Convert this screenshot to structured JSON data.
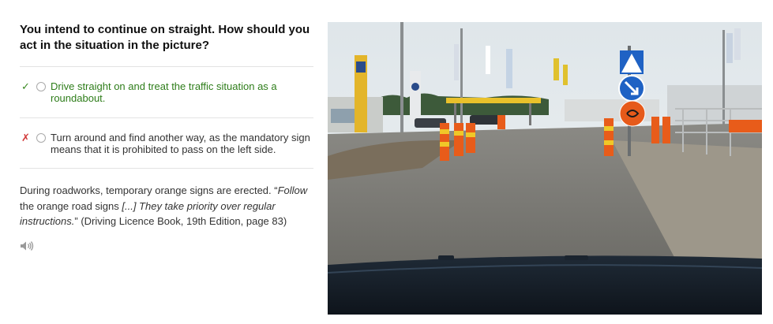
{
  "question": {
    "text": "You intend to continue on straight. How should you act in the situation in the picture?"
  },
  "options": [
    {
      "text": "Drive straight on and treat the traffic situation as a roundabout.",
      "status": "correct",
      "marker": "✓",
      "color": "#2e7d1a"
    },
    {
      "text": "Turn around and find another way, as the mandatory sign means that it is prohibited to pass on the left side.",
      "status": "incorrect",
      "marker": "✗",
      "color": "#d23a3a"
    }
  ],
  "explanation": {
    "part1": "During roadworks, temporary orange signs are erected. “",
    "italic1": "Follow",
    "part2": " the orange road signs ",
    "italic2": "[...] They take priority over regular instructions.",
    "part3": "” (Driving Licence Book, 19th Edition, page 83)"
  },
  "audio": {
    "icon": "speaker-icon"
  },
  "photo": {
    "description_icon": "roadworks-scene-image"
  }
}
